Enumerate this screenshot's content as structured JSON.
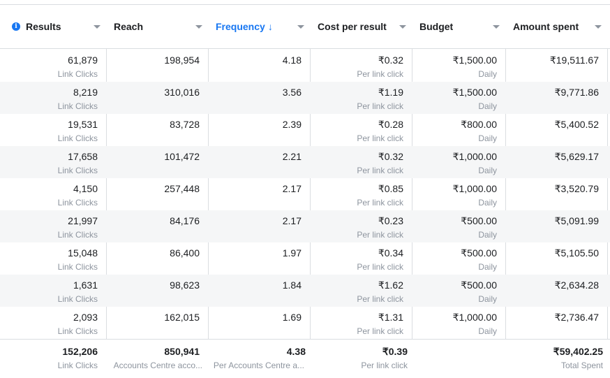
{
  "columns": [
    {
      "label": "Results"
    },
    {
      "label": "Reach"
    },
    {
      "label": "Frequency"
    },
    {
      "label": "Cost per result"
    },
    {
      "label": "Budget"
    },
    {
      "label": "Amount spent"
    }
  ],
  "sort_arrow": "↓",
  "rows": [
    {
      "results": "61,879",
      "results_sub": "Link Clicks",
      "reach": "198,954",
      "frequency": "4.18",
      "cost": "₹0.32",
      "cost_sub": "Per link click",
      "budget": "₹1,500.00",
      "budget_sub": "Daily",
      "spent": "₹19,511.67"
    },
    {
      "results": "8,219",
      "results_sub": "Link Clicks",
      "reach": "310,016",
      "frequency": "3.56",
      "cost": "₹1.19",
      "cost_sub": "Per link click",
      "budget": "₹1,500.00",
      "budget_sub": "Daily",
      "spent": "₹9,771.86"
    },
    {
      "results": "19,531",
      "results_sub": "Link Clicks",
      "reach": "83,728",
      "frequency": "2.39",
      "cost": "₹0.28",
      "cost_sub": "Per link click",
      "budget": "₹800.00",
      "budget_sub": "Daily",
      "spent": "₹5,400.52"
    },
    {
      "results": "17,658",
      "results_sub": "Link Clicks",
      "reach": "101,472",
      "frequency": "2.21",
      "cost": "₹0.32",
      "cost_sub": "Per link click",
      "budget": "₹1,000.00",
      "budget_sub": "Daily",
      "spent": "₹5,629.17"
    },
    {
      "results": "4,150",
      "results_sub": "Link Clicks",
      "reach": "257,448",
      "frequency": "2.17",
      "cost": "₹0.85",
      "cost_sub": "Per link click",
      "budget": "₹1,000.00",
      "budget_sub": "Daily",
      "spent": "₹3,520.79"
    },
    {
      "results": "21,997",
      "results_sub": "Link Clicks",
      "reach": "84,176",
      "frequency": "2.17",
      "cost": "₹0.23",
      "cost_sub": "Per link click",
      "budget": "₹500.00",
      "budget_sub": "Daily",
      "spent": "₹5,091.99"
    },
    {
      "results": "15,048",
      "results_sub": "Link Clicks",
      "reach": "86,400",
      "frequency": "1.97",
      "cost": "₹0.34",
      "cost_sub": "Per link click",
      "budget": "₹500.00",
      "budget_sub": "Daily",
      "spent": "₹5,105.50"
    },
    {
      "results": "1,631",
      "results_sub": "Link Clicks",
      "reach": "98,623",
      "frequency": "1.84",
      "cost": "₹1.62",
      "cost_sub": "Per link click",
      "budget": "₹500.00",
      "budget_sub": "Daily",
      "spent": "₹2,634.28"
    },
    {
      "results": "2,093",
      "results_sub": "Link Clicks",
      "reach": "162,015",
      "frequency": "1.69",
      "cost": "₹1.31",
      "cost_sub": "Per link click",
      "budget": "₹1,000.00",
      "budget_sub": "Daily",
      "spent": "₹2,736.47"
    }
  ],
  "totals": {
    "results": "152,206",
    "results_sub": "Link Clicks",
    "reach": "850,941",
    "reach_sub": "Accounts Centre acco...",
    "frequency": "4.38",
    "frequency_sub": "Per Accounts Centre a...",
    "cost": "₹0.39",
    "cost_sub": "Per link click",
    "budget": "",
    "budget_sub": "",
    "spent": "₹59,402.25",
    "spent_sub": "Total Spent"
  },
  "colors": {
    "accent": "#1877f2",
    "alt_row": "#f5f6f7",
    "muted": "#8d949e",
    "border": "#dadde1"
  }
}
